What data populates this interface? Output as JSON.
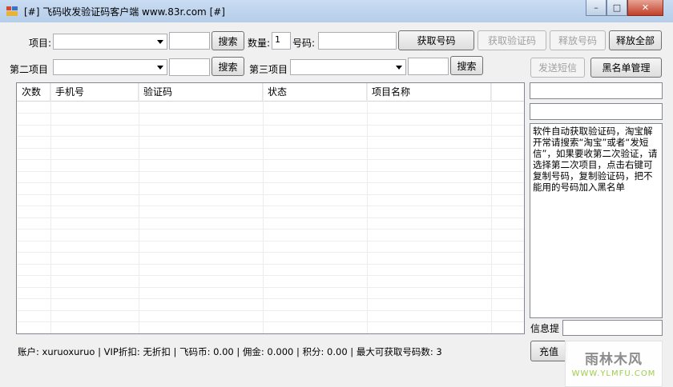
{
  "window": {
    "title": "[#] 飞码收发验证码客户端  www.83r.com [#]",
    "min_glyph": "–",
    "max_glyph": "□",
    "close_glyph": "✕"
  },
  "toolbar": {
    "project_label": "项目:",
    "project_value": "",
    "search_label": "搜索",
    "quantity_label": "数量:",
    "quantity_value": "1",
    "number_label": "号码:",
    "number_value": "",
    "get_number_label": "获取号码",
    "get_code_label": "获取验证码",
    "release_number_label": "释放号码",
    "release_all_label": "释放全部",
    "project2_label": "第二项目",
    "project2_value": "",
    "search2_label": "搜索",
    "project3_label": "第三项目",
    "project3_value": "",
    "search3_label": "搜索",
    "send_sms_label": "发送短信",
    "blacklist_label": "黑名单管理"
  },
  "table": {
    "columns": [
      "次数",
      "手机号",
      "验证码",
      "状态",
      "项目名称"
    ],
    "rows": []
  },
  "side": {
    "field1": "",
    "field2": "",
    "notice": "软件自动获取验证码，淘宝解开常请搜索“淘宝”或者“发短信”，如果要收第二次验证，请选择第二次项目，点击右键可复制号码，复制验证码，把不能用的号码加入黑名单",
    "info_label": "信息提",
    "recharge_label": "充值"
  },
  "status": {
    "text": "账户: xuruoxuruo  |  VIP折扣: 无折扣  |  飞码币: 0.00  |  佣金: 0.000  |  积分: 0.00  |  最大可获取号码数: 3"
  },
  "watermark": {
    "main": "雨林木风",
    "sub": "WWW.YLMFU.COM"
  }
}
